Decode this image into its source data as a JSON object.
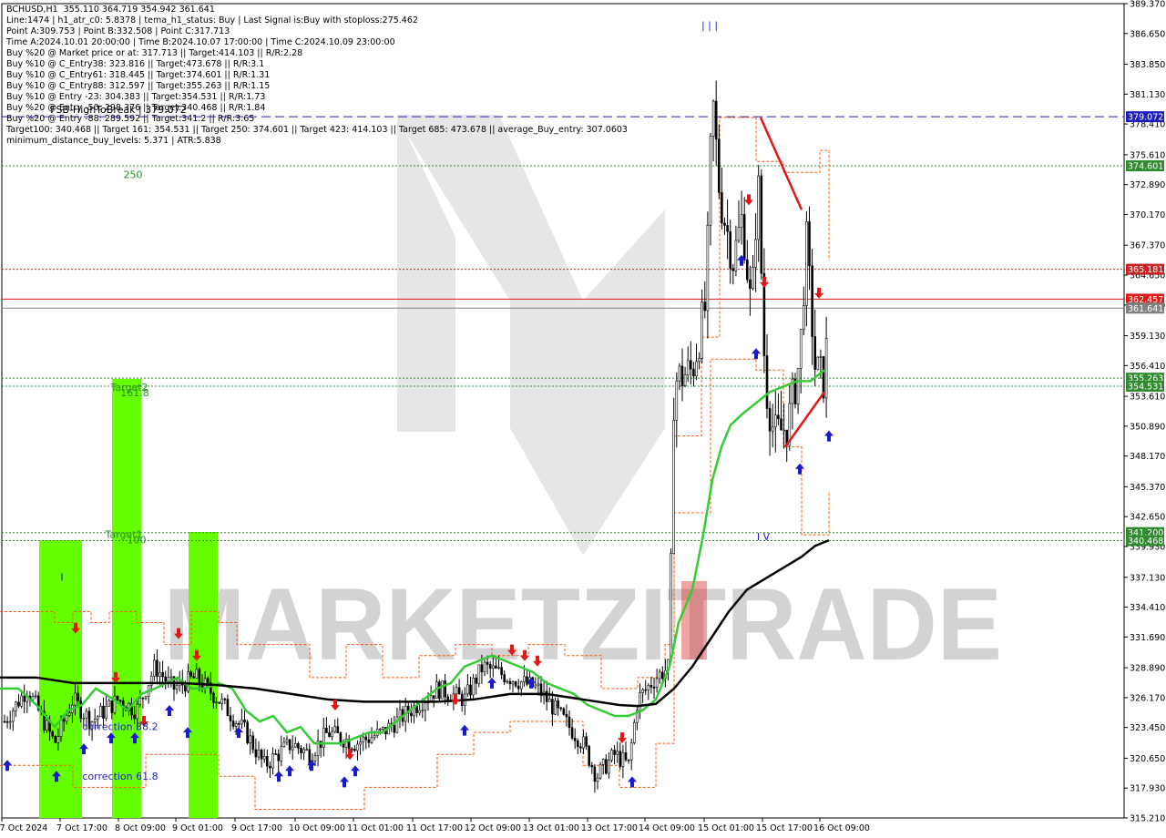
{
  "info_lines": [
    "BCHUSD,H1  355.110 364.719 354.942 361.641",
    "Line:1474 | h1_atr_c0: 5.8378 | tema_h1_status: Buy | Last Signal is:Buy with stoploss:275.462",
    "Point A:309.753 | Point B:332.508 | Point C:317.713",
    "Time A:2024.10.01 20:00:00 | Time B:2024.10.07 17:00:00 | Time C:2024.10.09 23:00:00",
    "Buy %20 @ Market price or at: 317.713 || Target:414.103 || R/R:2.28",
    "Buy %10 @ C_Entry38: 323.816 || Target:473.678 || R/R:3.1",
    "Buy %10 @ C_Entry61: 318.445 || Target:374.601 || R/R:1.31",
    "Buy %10 @ C_Entry88: 312.597 || Target:355.263 || R/R:1.15",
    "Buy %10 @ Entry -23: 304.383 || Target:354.531 || R/R:1.73",
    "Buy %20 @ Entry -50: 298.376 || Target:340.468 || R/R:1.84",
    "Buy %20 @ Entry -88: 289.592 || Target:341.2 || R/R:3.65",
    "Target100: 340.468 || Target 161: 354.531 || Target 250: 374.601 || Target 423: 414.103 || Target 685: 473.678 || average_Buy_entry: 307.0603",
    "minimum_distance_buy_levels: 5.371 | ATR:5.838"
  ],
  "chart_data": {
    "type": "candlestick",
    "symbol": "BCHUSD",
    "timeframe": "H1",
    "ylim": [
      315.21,
      389.37
    ],
    "y_ticks": [
      "389.370",
      "386.650",
      "383.850",
      "381.130",
      "378.410",
      "375.610",
      "372.890",
      "370.170",
      "367.370",
      "364.650",
      "361.930",
      "359.130",
      "356.410",
      "353.610",
      "350.890",
      "348.170",
      "345.370",
      "342.650",
      "339.930",
      "337.130",
      "334.410",
      "331.690",
      "328.890",
      "326.170",
      "323.450",
      "320.650",
      "317.930",
      "315.210"
    ],
    "x_ticks": [
      "7 Oct 2024",
      "7 Oct 17:00",
      "8 Oct 09:00",
      "9 Oct 01:00",
      "9 Oct 17:00",
      "10 Oct 09:00",
      "11 Oct 01:00",
      "11 Oct 17:00",
      "12 Oct 09:00",
      "13 Oct 01:00",
      "13 Oct 17:00",
      "14 Oct 09:00",
      "15 Oct 01:00",
      "15 Oct 17:00",
      "16 Oct 09:00"
    ],
    "last_close": 361.641,
    "series_trend": [
      [
        0,
        327
      ],
      [
        20,
        327
      ],
      [
        40,
        325.5
      ],
      [
        60,
        323.5
      ],
      [
        75,
        325
      ],
      [
        90,
        325.5
      ],
      [
        105,
        327
      ],
      [
        125,
        326
      ],
      [
        140,
        325
      ],
      [
        155,
        326.5
      ],
      [
        170,
        327
      ],
      [
        195,
        328
      ],
      [
        210,
        327
      ],
      [
        225,
        327
      ],
      [
        240,
        327.5
      ],
      [
        255,
        327
      ],
      [
        270,
        325
      ],
      [
        285,
        324
      ],
      [
        300,
        324.5
      ],
      [
        315,
        323
      ],
      [
        330,
        323.5
      ],
      [
        345,
        322
      ],
      [
        360,
        322
      ],
      [
        375,
        322
      ],
      [
        390,
        322.5
      ],
      [
        405,
        323
      ],
      [
        420,
        323
      ],
      [
        435,
        324
      ],
      [
        450,
        325
      ],
      [
        465,
        326
      ],
      [
        480,
        327
      ],
      [
        495,
        327.5
      ],
      [
        510,
        329
      ],
      [
        525,
        329.5
      ],
      [
        540,
        330
      ],
      [
        555,
        329.5
      ],
      [
        570,
        329
      ],
      [
        585,
        328.5
      ],
      [
        600,
        327.5
      ],
      [
        615,
        327
      ],
      [
        630,
        326.5
      ],
      [
        645,
        325.5
      ],
      [
        660,
        325
      ],
      [
        675,
        324.5
      ],
      [
        690,
        324.5
      ],
      [
        705,
        325
      ],
      [
        720,
        326
      ],
      [
        735,
        329
      ],
      [
        745,
        333
      ],
      [
        760,
        336
      ],
      [
        772,
        341
      ],
      [
        782,
        346
      ],
      [
        792,
        349
      ],
      [
        802,
        351
      ],
      [
        815,
        352
      ],
      [
        830,
        353
      ],
      [
        845,
        354
      ],
      [
        860,
        354.5
      ],
      [
        875,
        355
      ],
      [
        890,
        355
      ],
      [
        905,
        356
      ]
    ],
    "series_slow_ma": [
      [
        0,
        328
      ],
      [
        40,
        328
      ],
      [
        80,
        327.5
      ],
      [
        120,
        327.5
      ],
      [
        160,
        327.5
      ],
      [
        200,
        327.5
      ],
      [
        240,
        327.3
      ],
      [
        280,
        327
      ],
      [
        320,
        326.5
      ],
      [
        360,
        326
      ],
      [
        400,
        325.8
      ],
      [
        440,
        325.8
      ],
      [
        480,
        325.8
      ],
      [
        520,
        326
      ],
      [
        560,
        326.5
      ],
      [
        600,
        326.5
      ],
      [
        640,
        326
      ],
      [
        680,
        325.5
      ],
      [
        700,
        325.4
      ],
      [
        720,
        325.6
      ],
      [
        740,
        327
      ],
      [
        760,
        329
      ],
      [
        780,
        331.5
      ],
      [
        800,
        334
      ],
      [
        820,
        336
      ],
      [
        840,
        337
      ],
      [
        860,
        338
      ],
      [
        880,
        339
      ],
      [
        895,
        340
      ],
      [
        910,
        340.5
      ]
    ],
    "levels": [
      {
        "label": "379.072",
        "value": 379.072,
        "color": "#1f1fbf",
        "style": "dashed"
      },
      {
        "label": "374.601",
        "value": 374.601,
        "color": "#2e8b2e",
        "style": "dotted"
      },
      {
        "label": "365.181",
        "value": 365.181,
        "color": "#cc2222",
        "style": "dotted"
      },
      {
        "label": "362.457",
        "value": 362.457,
        "color": "#e01818",
        "style": "solid"
      },
      {
        "label": "361.641",
        "value": 361.641,
        "color": "#808080",
        "style": "solid"
      },
      {
        "label": "355.263",
        "value": 355.263,
        "color": "#2e8b2e",
        "style": "dotted"
      },
      {
        "label": "354.531",
        "value": 354.531,
        "color": "#2e8b2e",
        "style": "dotted"
      },
      {
        "label": "341.200",
        "value": 341.2,
        "color": "#2e8b2e",
        "style": "dotted"
      },
      {
        "label": "340.468",
        "value": 340.468,
        "color": "#2e8b2e",
        "style": "dotted"
      }
    ],
    "annotations": [
      {
        "text": "250",
        "x": 146,
        "v": 373.5,
        "color": "#2e8b2e"
      },
      {
        "text": "Target2",
        "x": 142,
        "v": 354.1,
        "color": "#2e8b2e"
      },
      {
        "text": "161.8",
        "x": 148,
        "v": 353.6,
        "color": "#2e8b2e"
      },
      {
        "text": "Target1",
        "x": 136,
        "v": 340.7,
        "color": "#2e8b2e"
      },
      {
        "text": "100",
        "x": 150,
        "v": 340.2,
        "color": "#2e8b2e"
      },
      {
        "text": "correction 38.2",
        "x": 132,
        "v": 323.2,
        "color": "#1f1fbf"
      },
      {
        "text": "correction 61.8",
        "x": 132,
        "v": 318.7,
        "color": "#1f1fbf"
      },
      {
        "text": "| | |",
        "x": 779,
        "v": 387.1,
        "color": "#1f1fbf"
      },
      {
        "text": "I V",
        "x": 838,
        "v": 340.5,
        "color": "#1f1fbf"
      },
      {
        "text": "I",
        "x": 68,
        "v": 336.8,
        "color": "#1f1fbf"
      },
      {
        "text": "FSB-HighToBreak | 379.072",
        "x": 130,
        "v": 379.4,
        "color": "#000000"
      }
    ],
    "watermark": "MARKETZITRADE"
  },
  "colors": {
    "bull_zone": "#66ff00",
    "trend_ma": "#33cc33",
    "slow_ma": "#000000",
    "up_arrow": "#1a1acc",
    "down_arrow": "#e01818"
  }
}
